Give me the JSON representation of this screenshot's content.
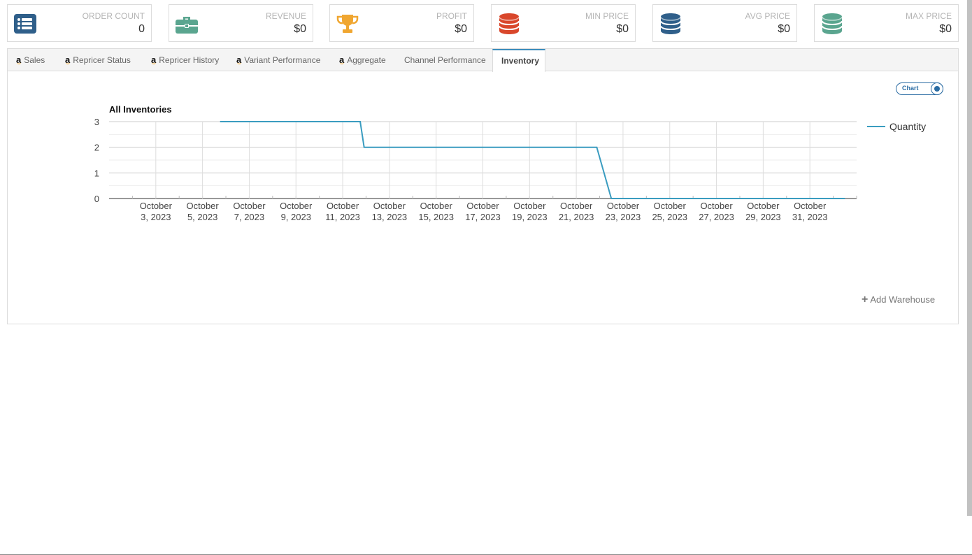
{
  "stats": [
    {
      "label": "ORDER COUNT",
      "value": "0",
      "icon": "list-icon",
      "color": "#2f5f8a"
    },
    {
      "label": "REVENUE",
      "value": "$0",
      "icon": "briefcase-icon",
      "color": "#5aa58f"
    },
    {
      "label": "PROFIT",
      "value": "$0",
      "icon": "trophy-icon",
      "color": "#f0a630"
    },
    {
      "label": "MIN PRICE",
      "value": "$0",
      "icon": "database-icon",
      "color": "#d9472b"
    },
    {
      "label": "AVG PRICE",
      "value": "$0",
      "icon": "database-icon",
      "color": "#2f5f8a"
    },
    {
      "label": "MAX PRICE",
      "value": "$0",
      "icon": "database-icon",
      "color": "#5aa58f"
    }
  ],
  "tabs": [
    {
      "label": "Sales",
      "amazon": true
    },
    {
      "label": "Repricer Status",
      "amazon": true
    },
    {
      "label": "Repricer History",
      "amazon": true
    },
    {
      "label": "Variant Performance",
      "amazon": true
    },
    {
      "label": "Aggregate",
      "amazon": true
    },
    {
      "label": "Channel Performance",
      "amazon": false
    },
    {
      "label": "Inventory",
      "amazon": false,
      "active": true
    }
  ],
  "amazon_glyph": "a",
  "toggle": {
    "label": "Chart",
    "on": true
  },
  "add_warehouse": {
    "icon": "plus-icon",
    "label": "Add Warehouse"
  },
  "chart_data": {
    "type": "line",
    "title": "All Inventories",
    "xlabel": "",
    "ylabel": "",
    "ylim": [
      0,
      3
    ],
    "yticks": [
      0,
      1,
      2,
      3
    ],
    "grid": true,
    "legend_position": "right",
    "line_color": "#3a9cc0",
    "x_tick_labels": [
      [
        "October",
        "3, 2023"
      ],
      [
        "October",
        "5, 2023"
      ],
      [
        "October",
        "7, 2023"
      ],
      [
        "October",
        "9, 2023"
      ],
      [
        "October",
        "11, 2023"
      ],
      [
        "October",
        "13, 2023"
      ],
      [
        "October",
        "15, 2023"
      ],
      [
        "October",
        "17, 2023"
      ],
      [
        "October",
        "19, 2023"
      ],
      [
        "October",
        "21, 2023"
      ],
      [
        "October",
        "23, 2023"
      ],
      [
        "October",
        "25, 2023"
      ],
      [
        "October",
        "27, 2023"
      ],
      [
        "October",
        "29, 2023"
      ],
      [
        "October",
        "31, 2023"
      ]
    ],
    "xlim": [
      "2023-10-01",
      "2023-11-02"
    ],
    "series": [
      {
        "name": "Quantity",
        "points": [
          {
            "x": "2023-10-05 18:00",
            "y": 3
          },
          {
            "x": "2023-10-11 18:00",
            "y": 3
          },
          {
            "x": "2023-10-11 22:00",
            "y": 2
          },
          {
            "x": "2023-10-21 21:00",
            "y": 2
          },
          {
            "x": "2023-10-22 12:00",
            "y": 0
          },
          {
            "x": "2023-11-01 12:00",
            "y": 0
          }
        ]
      }
    ]
  }
}
